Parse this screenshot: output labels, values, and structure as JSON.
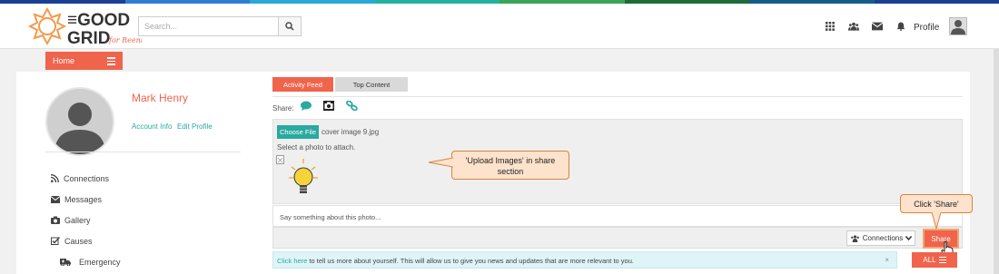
{
  "colors": {
    "accent": "#f0644c",
    "teal": "#2aa9a0",
    "topbar": [
      "#1b3f95",
      "#2f7fd0",
      "#29a9d6",
      "#24b0a0",
      "#3aa556",
      "#1d6c3a",
      "#155d8c",
      "#1b3f95"
    ]
  },
  "header": {
    "logo_line1": "THE GOOD",
    "logo_line2": "GRID",
    "logo_tagline": "for Reentry",
    "search_placeholder": "Search...",
    "icons": [
      "apps-grid-icon",
      "group-icon",
      "envelope-icon",
      "bell-icon"
    ],
    "profile_label": "Profile"
  },
  "nav": {
    "home_label": "Home"
  },
  "profile": {
    "name": "Mark Henry",
    "account_info": "Account Info",
    "edit_profile": "Edit Profile"
  },
  "sidebar": {
    "items": [
      {
        "label": "Connections",
        "icon": "rss-icon"
      },
      {
        "label": "Messages",
        "icon": "envelope-icon"
      },
      {
        "label": "Gallery",
        "icon": "camera-icon"
      },
      {
        "label": "Causes",
        "icon": "checkbox-icon"
      },
      {
        "label": "Emergency",
        "icon": "ambulance-icon"
      }
    ]
  },
  "tabs": [
    {
      "label": "Activity Feed",
      "active": true
    },
    {
      "label": "Top Content",
      "active": false
    }
  ],
  "share": {
    "label": "Share:",
    "choose_file": "Choose File",
    "file_name": "cover image 9.jpg",
    "select_prompt": "Select a photo to attach.",
    "say_placeholder": "Say something about this photo...",
    "connections_label": "Connections",
    "share_button": "Share"
  },
  "callouts": {
    "upload_line1": "'Upload Images' in share",
    "upload_line2": "section",
    "click_share": "Click 'Share'"
  },
  "info_bar": {
    "link": "Click here",
    "text": " to tell us more about yourself. This will allow us to give you news and updates that are more relevant to you.",
    "close": "×",
    "all_label": "ALL"
  }
}
